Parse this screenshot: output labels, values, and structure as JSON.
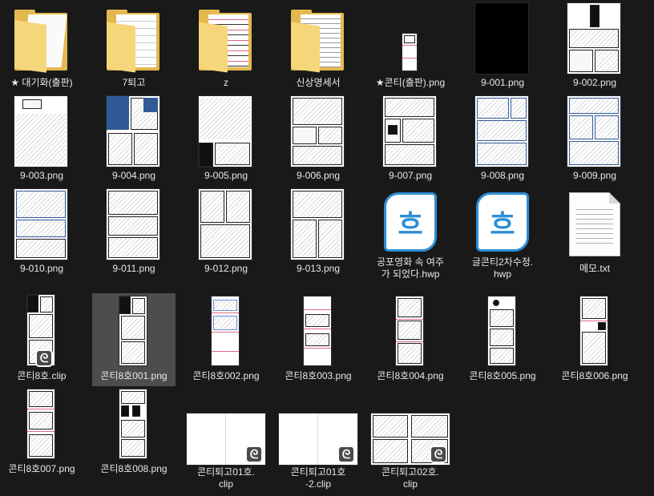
{
  "explorer": {
    "items": [
      {
        "name": "★ 대기화(출판)",
        "kind": "folder"
      },
      {
        "name": "7퇴고",
        "kind": "folder"
      },
      {
        "name": "z",
        "kind": "folder"
      },
      {
        "name": "신상명세서",
        "kind": "folder"
      },
      {
        "name": "★콘티(출판).png",
        "kind": "png"
      },
      {
        "name": "9-001.png",
        "kind": "png"
      },
      {
        "name": "9-002.png",
        "kind": "png"
      },
      {
        "name": "9-003.png",
        "kind": "png"
      },
      {
        "name": "9-004.png",
        "kind": "png"
      },
      {
        "name": "9-005.png",
        "kind": "png"
      },
      {
        "name": "9-006.png",
        "kind": "png"
      },
      {
        "name": "9-007.png",
        "kind": "png"
      },
      {
        "name": "9-008.png",
        "kind": "png"
      },
      {
        "name": "9-009.png",
        "kind": "png"
      },
      {
        "name": "9-010.png",
        "kind": "png"
      },
      {
        "name": "9-011.png",
        "kind": "png"
      },
      {
        "name": "9-012.png",
        "kind": "png"
      },
      {
        "name": "9-013.png",
        "kind": "png"
      },
      {
        "name": "공포영화 속 여주\n가 되었다.hwp",
        "kind": "hwp"
      },
      {
        "name": "글콘티2차수정.\nhwp",
        "kind": "hwp"
      },
      {
        "name": "메모.txt",
        "kind": "txt"
      },
      {
        "name": "콘티8호.clip",
        "kind": "clip"
      },
      {
        "name": "콘티8호001.png",
        "kind": "png"
      },
      {
        "name": "콘티8호002.png",
        "kind": "png"
      },
      {
        "name": "콘티8호003.png",
        "kind": "png"
      },
      {
        "name": "콘티8호004.png",
        "kind": "png"
      },
      {
        "name": "콘티8호005.png",
        "kind": "png"
      },
      {
        "name": "콘티8호006.png",
        "kind": "png"
      },
      {
        "name": "콘티8호007.png",
        "kind": "png"
      },
      {
        "name": "콘티8호008.png",
        "kind": "png"
      },
      {
        "name": "콘티퇴고01호.\nclip",
        "kind": "clip"
      },
      {
        "name": "콘티퇴고01호\n-2.clip",
        "kind": "clip"
      },
      {
        "name": "콘티퇴고02호.\nclip",
        "kind": "clip"
      }
    ],
    "selected_item": "콘티8호001.png",
    "hwp_glyph": "흐",
    "clip_glyph": "ᘓ",
    "colors": {
      "background": "#191919",
      "selected": "#4d4d4d",
      "folder": "#f6d67b",
      "hwp": "#2c8ed6"
    }
  }
}
